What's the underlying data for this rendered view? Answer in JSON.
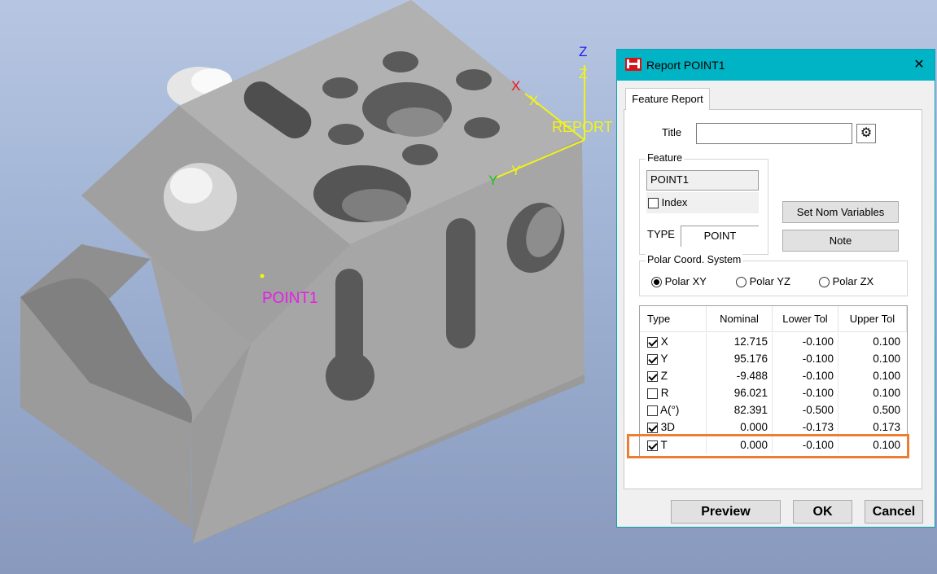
{
  "viewport": {
    "point_label": "POINT1",
    "axis_labels": {
      "z_top": "Z",
      "z_mid": "Z",
      "x_red": "X",
      "x_yellow": "X",
      "report": "REPORT",
      "y_green": "Y",
      "y_yellow": "Y"
    },
    "colors": {
      "point_label": "#e81be8",
      "axis_yellow": "#f2f21a",
      "axis_red": "#e81a1a",
      "axis_blue": "#1a1aee",
      "axis_green": "#1ac41a"
    }
  },
  "dialog": {
    "title": "Report POINT1",
    "close_glyph": "✕",
    "tab_label": "Feature Report",
    "title_field": {
      "label": "Title",
      "value": ""
    },
    "feature_group": {
      "title": "Feature",
      "feature_value": "POINT1",
      "index_label": "Index",
      "index_checked": false,
      "type_label": "TYPE",
      "type_value": "POINT"
    },
    "buttons": {
      "set_nom": "Set Nom Variables",
      "note": "Note",
      "preview": "Preview",
      "ok": "OK",
      "cancel": "Cancel"
    },
    "polar_group": {
      "title": "Polar Coord. System",
      "options": [
        "Polar XY",
        "Polar YZ",
        "Polar ZX"
      ],
      "selected": "Polar XY"
    },
    "table": {
      "headers": [
        "Type",
        "Nominal",
        "Lower Tol",
        "Upper Tol"
      ],
      "rows": [
        {
          "type": "X",
          "checked": true,
          "nominal": "12.715",
          "lower": "-0.100",
          "upper": "0.100"
        },
        {
          "type": "Y",
          "checked": true,
          "nominal": "95.176",
          "lower": "-0.100",
          "upper": "0.100"
        },
        {
          "type": "Z",
          "checked": true,
          "nominal": "-9.488",
          "lower": "-0.100",
          "upper": "0.100"
        },
        {
          "type": "R",
          "checked": false,
          "nominal": "96.021",
          "lower": "-0.100",
          "upper": "0.100"
        },
        {
          "type": "A(°)",
          "checked": false,
          "nominal": "82.391",
          "lower": "-0.500",
          "upper": "0.500"
        },
        {
          "type": "3D",
          "checked": true,
          "nominal": "0.000",
          "lower": "-0.173",
          "upper": "0.173"
        },
        {
          "type": "T",
          "checked": true,
          "nominal": "0.000",
          "lower": "-0.100",
          "upper": "0.100"
        }
      ],
      "highlighted_row": "T",
      "highlight_color": "#ed7d31"
    }
  }
}
